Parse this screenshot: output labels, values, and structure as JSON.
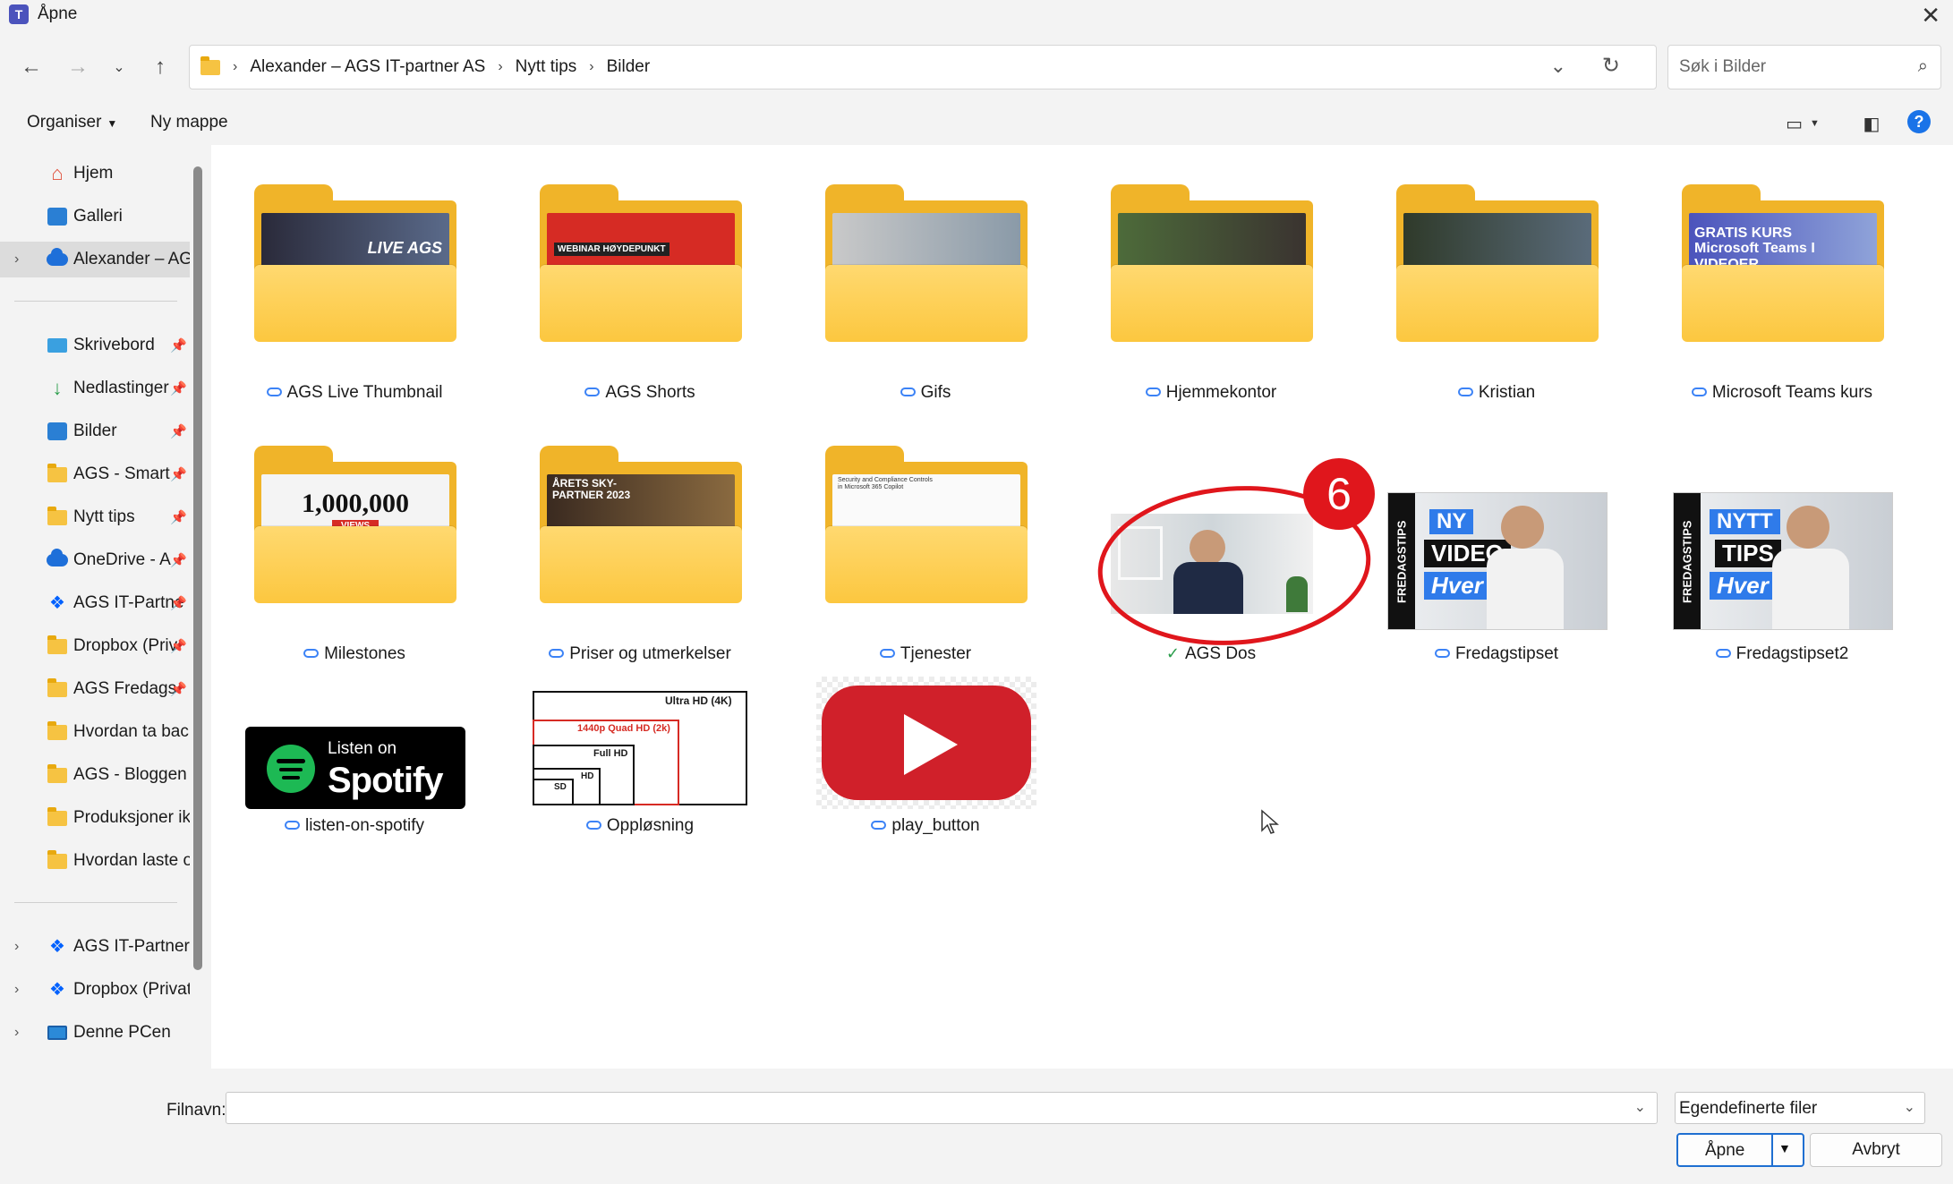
{
  "window": {
    "title": "Åpne",
    "app_icon": "teams-icon",
    "close_icon": "close-icon"
  },
  "nav": {
    "breadcrumbs": [
      "Alexander – AGS IT-partner AS",
      "Nytt tips",
      "Bilder"
    ],
    "search_placeholder": "Søk i Bilder"
  },
  "toolbar": {
    "organize_label": "Organiser",
    "new_folder_label": "Ny mappe"
  },
  "sidebar": {
    "top_items": [
      {
        "label": "Hjem",
        "icon": "home-icon"
      },
      {
        "label": "Galleri",
        "icon": "gallery-icon"
      },
      {
        "label": "Alexander – AGS",
        "icon": "onedrive-icon",
        "selected": true
      }
    ],
    "pinned_items": [
      {
        "label": "Skrivebord",
        "icon": "desktop-icon"
      },
      {
        "label": "Nedlastinger",
        "icon": "download-icon"
      },
      {
        "label": "Bilder",
        "icon": "pictures-icon"
      },
      {
        "label": "AGS - Smart",
        "icon": "folder-icon"
      },
      {
        "label": "Nytt tips",
        "icon": "folder-icon"
      },
      {
        "label": "OneDrive - A",
        "icon": "onedrive-icon"
      },
      {
        "label": "AGS IT-Partne",
        "icon": "dropbox-icon"
      },
      {
        "label": "Dropbox (Priv",
        "icon": "folder-icon"
      },
      {
        "label": "AGS Fredags",
        "icon": "folder-icon"
      },
      {
        "label": "Hvordan ta back",
        "icon": "folder-icon"
      },
      {
        "label": "AGS - Bloggen",
        "icon": "folder-icon"
      },
      {
        "label": "Produksjoner ikk",
        "icon": "folder-icon"
      },
      {
        "label": "Hvordan laste o",
        "icon": "folder-icon"
      }
    ],
    "bottom_items": [
      {
        "label": "AGS IT-Partner I",
        "icon": "dropbox-icon"
      },
      {
        "label": "Dropbox (Privat)",
        "icon": "dropbox-icon"
      },
      {
        "label": "Denne PCen",
        "icon": "pc-icon"
      }
    ]
  },
  "folders": [
    {
      "name": "AGS Live Thumbnail",
      "thumb_text": "LIVE AGS"
    },
    {
      "name": "AGS Shorts",
      "thumb_text": "WEBINAR HØYDEPUNKT"
    },
    {
      "name": "Gifs",
      "thumb_text": ""
    },
    {
      "name": "Hjemmekontor",
      "thumb_text": ""
    },
    {
      "name": "Kristian",
      "thumb_text": ""
    },
    {
      "name": "Microsoft Teams kurs",
      "thumb_text": "GRATIS KURS Microsoft Teams I VIDEOER"
    },
    {
      "name": "Milestones",
      "thumb_text": "1,000,000",
      "thumb_sub": "VIEWS"
    },
    {
      "name": "Priser og utmerkelser",
      "thumb_text": "ÅRETS SKY-PARTNER 2023"
    },
    {
      "name": "Tjenester",
      "thumb_text": "Security and Compliance Controls in Microsoft 365 Copilot"
    }
  ],
  "images": [
    {
      "name": "AGS Dos",
      "status": "synced",
      "badge": "6"
    },
    {
      "name": "Fredagstipset",
      "side_text": "FREDAGSTIPS",
      "line1": "NY",
      "line2": "VIDEO",
      "line3": "Hver Uke"
    },
    {
      "name": "Fredagstipset2",
      "side_text": "FREDAGSTIPS",
      "line1": "NYTT",
      "line2": "TIPS",
      "line3": "Hver Uke"
    },
    {
      "name": "listen-on-spotify",
      "line1": "Listen on",
      "line2": "Spotify"
    },
    {
      "name": "Oppløsning",
      "r1": "Ultra HD (4K)",
      "r2": "1440p Quad HD (2k)",
      "r3": "Full HD",
      "r4": "HD",
      "r5": "SD"
    },
    {
      "name": "play_button"
    }
  ],
  "footer": {
    "filename_label": "Filnavn:",
    "filename_value": "",
    "filter_value": "Egendefinerte filer",
    "open_label": "Åpne",
    "cancel_label": "Avbryt"
  },
  "colors": {
    "accent": "#1f6fd1",
    "folder": "#f0b429",
    "badge": "#e0161c"
  }
}
